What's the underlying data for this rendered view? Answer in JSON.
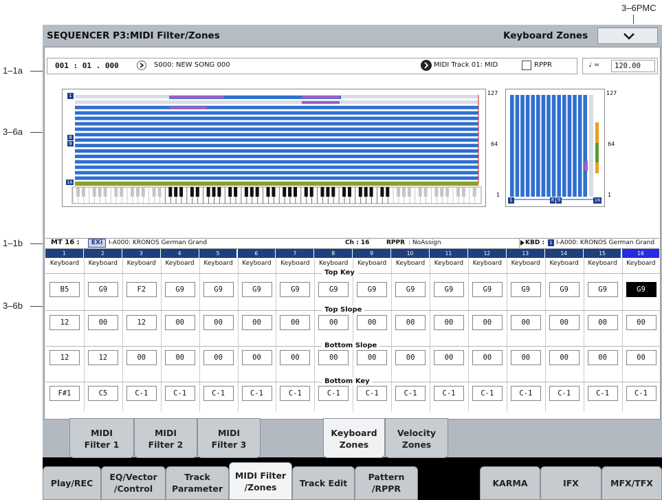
{
  "callouts": {
    "pmc": "3–6PMC",
    "c1a": "1–1a",
    "c6a": "3–6a",
    "c1b": "1–1b",
    "c6b": "3–6b"
  },
  "header": {
    "title": "SEQUENCER P3:MIDI Filter/Zones",
    "page": "Keyboard Zones",
    "pmc_icon": "chevron-down-arrow"
  },
  "song": {
    "location": "001 : 01 . 000",
    "song_name": "S000: NEW SONG 000",
    "track": "MIDI Track 01: MID",
    "rppr_label": "RPPR",
    "tempo_symbol": "♩ =",
    "tempo": "120.00"
  },
  "graph": {
    "left_top_num": "1",
    "left_marker_8": "8",
    "left_marker_9": "9",
    "left_marker_16": "16",
    "vel_127_left": "127",
    "vel_64_left": "64",
    "vel_1_left": "1",
    "vel_127_right": "127",
    "vel_64_right": "64",
    "vel_1_right": "1",
    "vel_marker_1": "1",
    "vel_marker_8": "8",
    "vel_marker_9": "9",
    "vel_marker_16": "16"
  },
  "info": {
    "mt_label": "MT 16 :",
    "exi": "EXi",
    "program": "I-A000: KRONOS German Grand",
    "ch": "Ch  : 16",
    "rppr": "RPPR",
    "rppr_value": ": NoAssign",
    "kbd_label": "KBD :",
    "kbd_num": "1",
    "kbd_program": "I-A000: KRONOS German Grand"
  },
  "tracks": {
    "numbers": [
      "1",
      "2",
      "3",
      "4",
      "5",
      "6",
      "7",
      "8",
      "9",
      "10",
      "11",
      "12",
      "13",
      "14",
      "15",
      "16"
    ],
    "types": [
      "Keyboard",
      "Keyboard",
      "Keyboard",
      "Keyboard",
      "Keyboard",
      "Keyboard",
      "Keyboard",
      "Keyboard",
      "Keyboard",
      "Keyboard",
      "Keyboard",
      "Keyboard",
      "Keyboard",
      "Keyboard",
      "Keyboard",
      "Keyboard"
    ],
    "top_key_label": "Top Key",
    "top_key": [
      "B5",
      "G9",
      "F2",
      "G9",
      "G9",
      "G9",
      "G9",
      "G9",
      "G9",
      "G9",
      "G9",
      "G9",
      "G9",
      "G9",
      "G9",
      "G9"
    ],
    "top_slope_label": "Top Slope",
    "top_slope": [
      "12",
      "00",
      "12",
      "00",
      "00",
      "00",
      "00",
      "00",
      "00",
      "00",
      "00",
      "00",
      "00",
      "00",
      "00",
      "00"
    ],
    "bottom_slope_label": "Bottom Slope",
    "bottom_slope": [
      "12",
      "12",
      "00",
      "00",
      "00",
      "00",
      "00",
      "00",
      "00",
      "00",
      "00",
      "00",
      "00",
      "00",
      "00",
      "00"
    ],
    "bottom_key_label": "Bottom Key",
    "bottom_key": [
      "F#1",
      "C5",
      "C-1",
      "C-1",
      "C-1",
      "C-1",
      "C-1",
      "C-1",
      "C-1",
      "C-1",
      "C-1",
      "C-1",
      "C-1",
      "C-1",
      "C-1",
      "C-1"
    ]
  },
  "subtabs": [
    {
      "label1": "MIDI",
      "label2": "Filter 1"
    },
    {
      "label1": "MIDI",
      "label2": "Filter 2"
    },
    {
      "label1": "MIDI",
      "label2": "Filter 3"
    },
    {
      "label1": "Keyboard",
      "label2": "Zones"
    },
    {
      "label1": "Velocity",
      "label2": "Zones"
    }
  ],
  "maintabs": [
    {
      "label1": "Play/REC",
      "label2": ""
    },
    {
      "label1": "EQ/Vector",
      "label2": "/Control"
    },
    {
      "label1": "Track",
      "label2": "Parameter"
    },
    {
      "label1": "MIDI Filter",
      "label2": "/Zones"
    },
    {
      "label1": "Track Edit",
      "label2": ""
    },
    {
      "label1": "Pattern",
      "label2": "/RPPR"
    },
    {
      "label1": "KARMA",
      "label2": ""
    },
    {
      "label1": "IFX",
      "label2": ""
    },
    {
      "label1": "MFX/TFX",
      "label2": ""
    }
  ],
  "colors": {
    "zone_bar": "#2f6fd0",
    "zone_dark": "#1c3f8a",
    "highlight": "#a25ec0",
    "selected_track": "#2a2ae0",
    "green_bar": "#8aa12a"
  }
}
